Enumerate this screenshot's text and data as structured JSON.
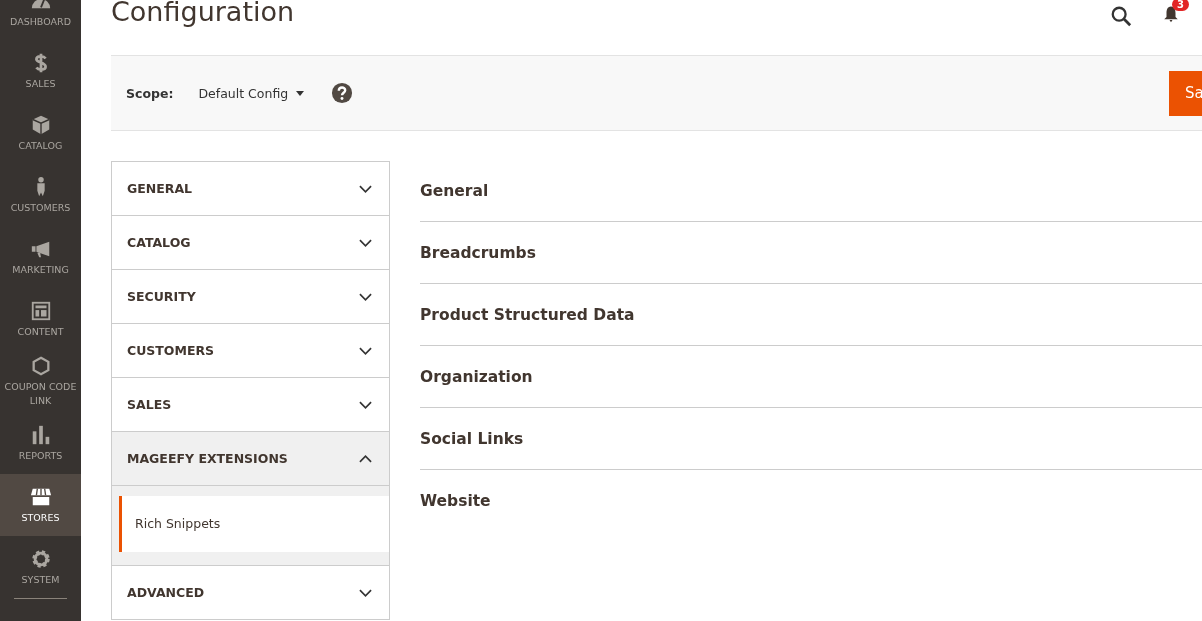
{
  "menu": [
    {
      "label": "DASHBOARD",
      "selected": false
    },
    {
      "label": "SALES",
      "selected": false
    },
    {
      "label": "CATALOG",
      "selected": false
    },
    {
      "label": "CUSTOMERS",
      "selected": false
    },
    {
      "label": "MARKETING",
      "selected": false
    },
    {
      "label": "CONTENT",
      "selected": false
    },
    {
      "label": "COUPON CODE LINK",
      "selected": false
    },
    {
      "label": "REPORTS",
      "selected": false
    },
    {
      "label": "STORES",
      "selected": true
    },
    {
      "label": "SYSTEM",
      "selected": false
    }
  ],
  "page_title": "Configuration",
  "notifications": {
    "count": "3"
  },
  "scope": {
    "label": "Scope:",
    "value": "Default Config"
  },
  "save_button": "Sa",
  "tabs": [
    {
      "label": "GENERAL",
      "expanded": false
    },
    {
      "label": "CATALOG",
      "expanded": false
    },
    {
      "label": "SECURITY",
      "expanded": false
    },
    {
      "label": "CUSTOMERS",
      "expanded": false
    },
    {
      "label": "SALES",
      "expanded": false
    },
    {
      "label": "MAGEEFY EXTENSIONS",
      "expanded": true,
      "children": [
        {
          "label": "Rich Snippets",
          "selected": true
        }
      ]
    },
    {
      "label": "ADVANCED",
      "expanded": false
    }
  ],
  "sections": [
    "General",
    "Breadcrumbs",
    "Product Structured Data",
    "Organization",
    "Social Links",
    "Website"
  ]
}
